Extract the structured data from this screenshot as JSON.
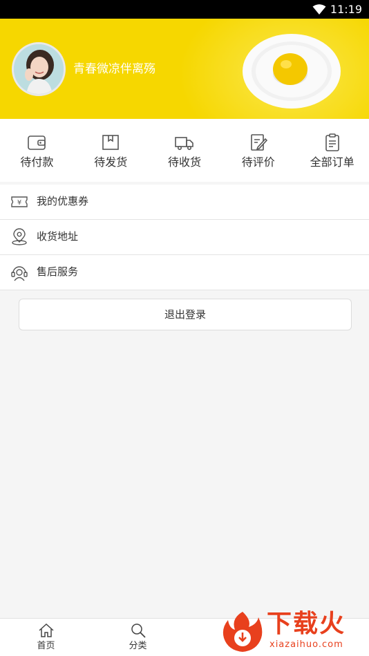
{
  "status_bar": {
    "time": "11:19",
    "wifi_icon": "wifi-icon"
  },
  "profile": {
    "username": "青春微凉伴离殇",
    "avatar_icon": "avatar-photo"
  },
  "orders": [
    {
      "label": "待付款",
      "icon": "wallet-icon"
    },
    {
      "label": "待发货",
      "icon": "package-icon"
    },
    {
      "label": "待收货",
      "icon": "truck-icon"
    },
    {
      "label": "待评价",
      "icon": "edit-note-icon"
    },
    {
      "label": "全部订单",
      "icon": "clipboard-icon"
    }
  ],
  "menu": [
    {
      "label": "我的优惠券",
      "icon": "coupon-icon"
    },
    {
      "label": "收货地址",
      "icon": "location-pin-icon"
    },
    {
      "label": "售后服务",
      "icon": "headset-icon"
    }
  ],
  "logout_label": "退出登录",
  "tabbar": [
    {
      "label": "首页",
      "icon": "home-icon"
    },
    {
      "label": "分类",
      "icon": "search-icon"
    }
  ],
  "watermark": {
    "title": "下载火",
    "subtitle": "xiazaihuo.com"
  },
  "colors": {
    "header_yellow": "#f6d700",
    "background": "#f5f5f5",
    "watermark_red": "#e8401d"
  }
}
